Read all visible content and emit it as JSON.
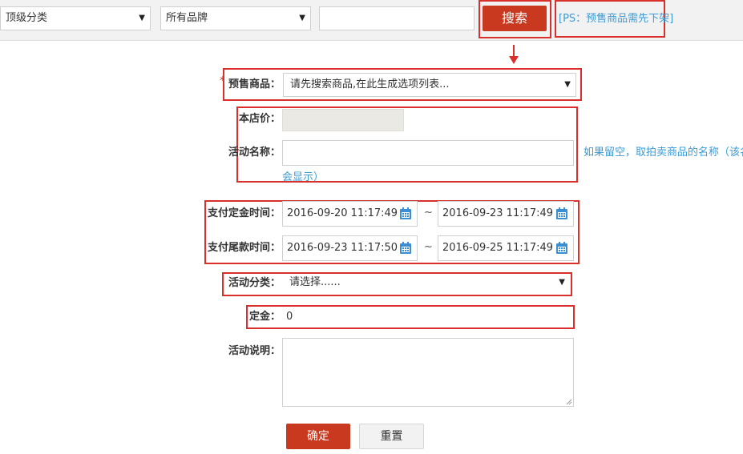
{
  "filter": {
    "category": "顶级分类",
    "brand": "所有品牌",
    "keyword": "",
    "search_label": "搜索",
    "ps_note": "[PS：预售商品需先下架]"
  },
  "form": {
    "presale_goods": {
      "required_mark": "*",
      "label": "预售商品：",
      "value": "请先搜索商品,在此生成选项列表..."
    },
    "store_price": {
      "label": "本店价：",
      "value": ""
    },
    "activity_name": {
      "label": "活动名称：",
      "value": "",
      "hint_line1": "如果留空，取拍卖商品的名称（该名",
      "hint_line2": "会显示）"
    },
    "deposit_time": {
      "label": "支付定金时间：",
      "start": "2016-09-20 11:17:49",
      "separator": "~",
      "end": "2016-09-23 11:17:49"
    },
    "balance_time": {
      "label": "支付尾款时间：",
      "start": "2016-09-23 11:17:50",
      "separator": "~",
      "end": "2016-09-25 11:17:49"
    },
    "activity_category": {
      "label": "活动分类：",
      "value": "请选择......"
    },
    "deposit": {
      "label": "定金：",
      "value": "0"
    },
    "description": {
      "label": "活动说明：",
      "value": ""
    }
  },
  "actions": {
    "confirm": "确定",
    "reset": "重置"
  },
  "colors": {
    "primary": "#c8391f",
    "highlight_border": "#d9302b",
    "link": "#3a9bd6",
    "icon_blue": "#3a8fd4"
  },
  "icons": {
    "calendar": "calendar-icon",
    "dropdown": "chevron-down-icon",
    "pointer": "arrow-down-icon"
  }
}
